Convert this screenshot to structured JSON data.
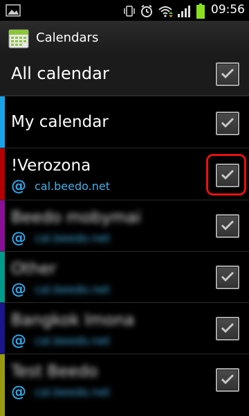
{
  "status_bar": {
    "time": "09:56",
    "icons": [
      "gallery-icon",
      "vibrate-icon",
      "alarm-icon",
      "wifi-icon",
      "signal-icon",
      "battery-icon"
    ]
  },
  "action_bar": {
    "title": "Calendars",
    "icon": "calendar-app-icon"
  },
  "all_calendar": {
    "label": "All calendar",
    "checked": true
  },
  "calendars": [
    {
      "name": "My calendar",
      "account": "",
      "color": "#18a3e8",
      "checked": true,
      "blurred": false
    },
    {
      "name": "!Verozona",
      "account": "cal.beedo.net",
      "color": "#b40000",
      "checked": true,
      "blurred": false,
      "highlighted": true
    },
    {
      "name": "Beedo mobymai",
      "account": "cal.beedo.net",
      "color": "#8a0f97",
      "checked": true,
      "blurred": true
    },
    {
      "name": "Other",
      "account": "cal.beedo.net",
      "color": "#009a8b",
      "checked": true,
      "blurred": true
    },
    {
      "name": "Bangkok Imona",
      "account": "cal.beedo.net",
      "color": "#1a158a",
      "checked": true,
      "blurred": true
    },
    {
      "name": "Test Beedo",
      "account": "cal.beedo.net",
      "color": "#9a9a12",
      "checked": true,
      "blurred": true
    }
  ],
  "colors": {
    "accent": "#29a5e6",
    "highlight": "#e81010"
  }
}
